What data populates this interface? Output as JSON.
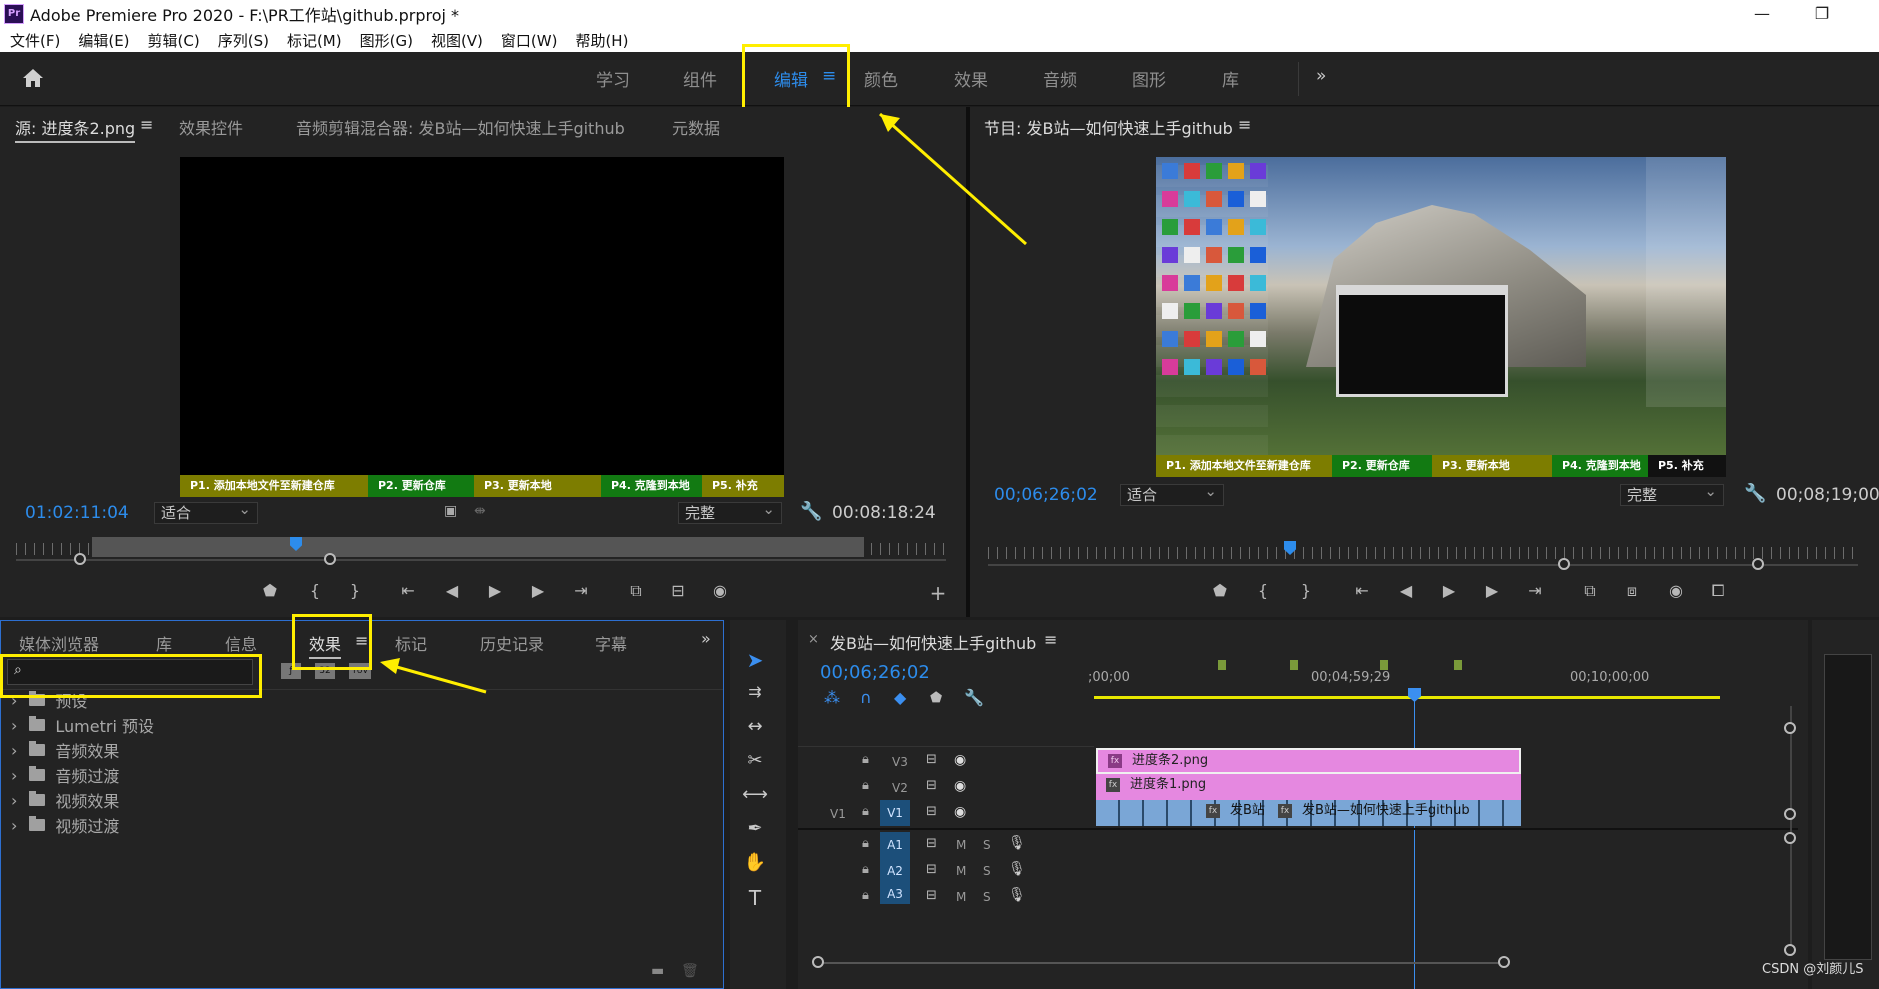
{
  "window": {
    "title": "Adobe Premiere Pro 2020 - F:\\PR工作站\\github.prproj *",
    "app_icon": "Pr"
  },
  "menu": [
    "文件(F)",
    "编辑(E)",
    "剪辑(C)",
    "序列(S)",
    "标记(M)",
    "图形(G)",
    "视图(V)",
    "窗口(W)",
    "帮助(H)"
  ],
  "workspaces": [
    "学习",
    "组件",
    "编辑",
    "颜色",
    "效果",
    "音频",
    "图形",
    "库"
  ],
  "workspace_active": "编辑",
  "source_panel": {
    "tabs": [
      "源: 进度条2.png",
      "效果控件",
      "音频剪辑混合器: 发B站—如何快速上手github",
      "元数据"
    ],
    "timecode": "01:02:11:04",
    "fit": "适合",
    "quality": "完整",
    "duration": "00:08:18:24"
  },
  "program_panel": {
    "title": "节目: 发B站—如何快速上手github",
    "timecode": "00;06;26;02",
    "fit": "适合",
    "quality": "完整",
    "duration": "00;08;19;00"
  },
  "progress_strip": [
    "P1. 添加本地文件至新建仓库",
    "P2. 更新仓库",
    "P3. 更新本地",
    "P4. 克隆到本地",
    "P5. 补充"
  ],
  "strip_colors": [
    "#7d7d00",
    "#127a12",
    "#7d7d00",
    "#127a12",
    "#7d7d00"
  ],
  "effects_panel": {
    "tabs": [
      "媒体浏览器",
      "库",
      "信息",
      "效果",
      "标记",
      "历史记录",
      "字幕"
    ],
    "search_placeholder": "",
    "filter_badges": [
      "32",
      "YUV"
    ],
    "items": [
      "预设",
      "Lumetri 预设",
      "音频效果",
      "音频过渡",
      "视频效果",
      "视频过渡"
    ]
  },
  "timeline": {
    "title": "发B站—如何快速上手github",
    "timecode": "00;06;26;02",
    "ruler": [
      ";00;00",
      "00;04;59;29",
      "00;10;00;00"
    ],
    "tracks": {
      "video": [
        "V3",
        "V2",
        "V1"
      ],
      "source_patch": "V1",
      "audio": [
        "A1",
        "A2",
        "A3"
      ],
      "audio_buttons": [
        "M",
        "S"
      ]
    },
    "clips": {
      "v3": "进度条2.png",
      "v2": "进度条1.png",
      "v1a": "发B站",
      "v1b": "发B站—如何快速上手github"
    }
  },
  "watermark": "CSDN @刘颜儿S"
}
